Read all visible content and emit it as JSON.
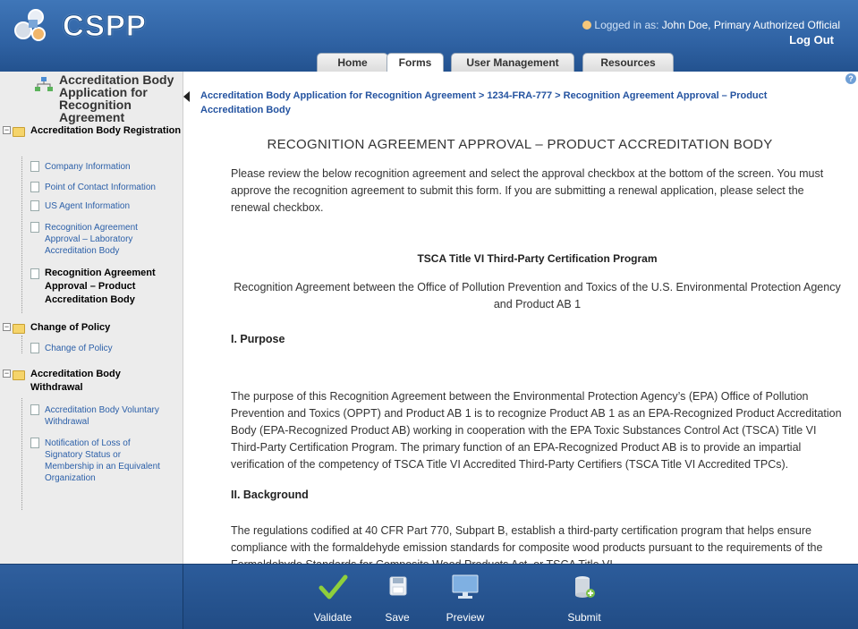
{
  "header": {
    "logo_text": "CSPP",
    "login_label": "Logged in as:",
    "login_user": "John Doe, Primary Authorized Official",
    "logout_label": "Log Out"
  },
  "tabs": [
    {
      "label": "Home",
      "active": false
    },
    {
      "label": "Forms",
      "active": true
    },
    {
      "label": "User Management",
      "active": false
    },
    {
      "label": "Resources",
      "active": false
    }
  ],
  "sidebar": {
    "title": "Accreditation Body Application for Recognition Agreement",
    "groups": [
      {
        "label": "Accreditation Body Registration",
        "items": [
          {
            "label": "Company Information"
          },
          {
            "label": "Point of Contact Information"
          },
          {
            "label": "US Agent Information"
          },
          {
            "label": "Recognition Agreement Approval – Laboratory Accreditation Body"
          },
          {
            "label": "Recognition Agreement Approval – Product Accreditation Body"
          }
        ]
      },
      {
        "label": "Change of Policy",
        "items": [
          {
            "label": "Change of Policy"
          }
        ]
      },
      {
        "label": "Accreditation Body Withdrawal",
        "items": [
          {
            "label": "Accreditation Body Voluntary Withdrawal"
          },
          {
            "label": "Notification of Loss of Signatory Status or Membership in an Equivalent Organization"
          }
        ]
      }
    ]
  },
  "main": {
    "breadcrumb": "Accreditation Body Application for Recognition Agreement > 1234-FRA-777 > Recognition Agreement Approval – Product Accreditation Body",
    "title": "RECOGNITION AGREEMENT APPROVAL – PRODUCT ACCREDITATION BODY",
    "intro": "Please review the below recognition agreement and select the approval checkbox at the bottom of the screen. You must approve the recognition agreement to submit this form. If you are submitting a renewal application, please select the renewal checkbox.",
    "program_title": "TSCA Title VI Third-Party Certification Program",
    "program_subtitle": "Recognition Agreement between the Office of Pollution Prevention and Toxics of the U.S. Environmental Protection Agency and Product AB 1",
    "purpose_heading": "I. Purpose",
    "purpose_text": "The purpose of this Recognition Agreement between the Environmental Protection Agency’s (EPA) Office of Pollution Prevention and Toxics (OPPT) and Product AB 1 is to recognize Product AB 1 as an EPA-Recognized Product Accreditation Body (EPA-Recognized Product AB) working in cooperation with the EPA Toxic Substances Control Act (TSCA) Title VI Third-Party Certification Program. The primary function of an EPA-Recognized Product AB is to provide an impartial verification of the competency of TSCA Title VI Accredited Third-Party Certifiers (TSCA Title VI Accredited TPCs).",
    "background_heading": "II. Background",
    "background_text": "The regulations codified at 40 CFR Part 770, Subpart B, establish a third-party certification program that helps ensure compliance with the formaldehyde emission standards for composite wood products pursuant to the requirements of the Formaldehyde Standards for Composite Wood Products Act, or TSCA Title VI."
  },
  "footer": {
    "buttons": [
      {
        "label": "Validate",
        "icon": "checkmark-icon"
      },
      {
        "label": "Save",
        "icon": "save-icon"
      },
      {
        "label": "Preview",
        "icon": "monitor-icon"
      },
      {
        "label": "Submit",
        "icon": "database-submit-icon"
      }
    ]
  }
}
